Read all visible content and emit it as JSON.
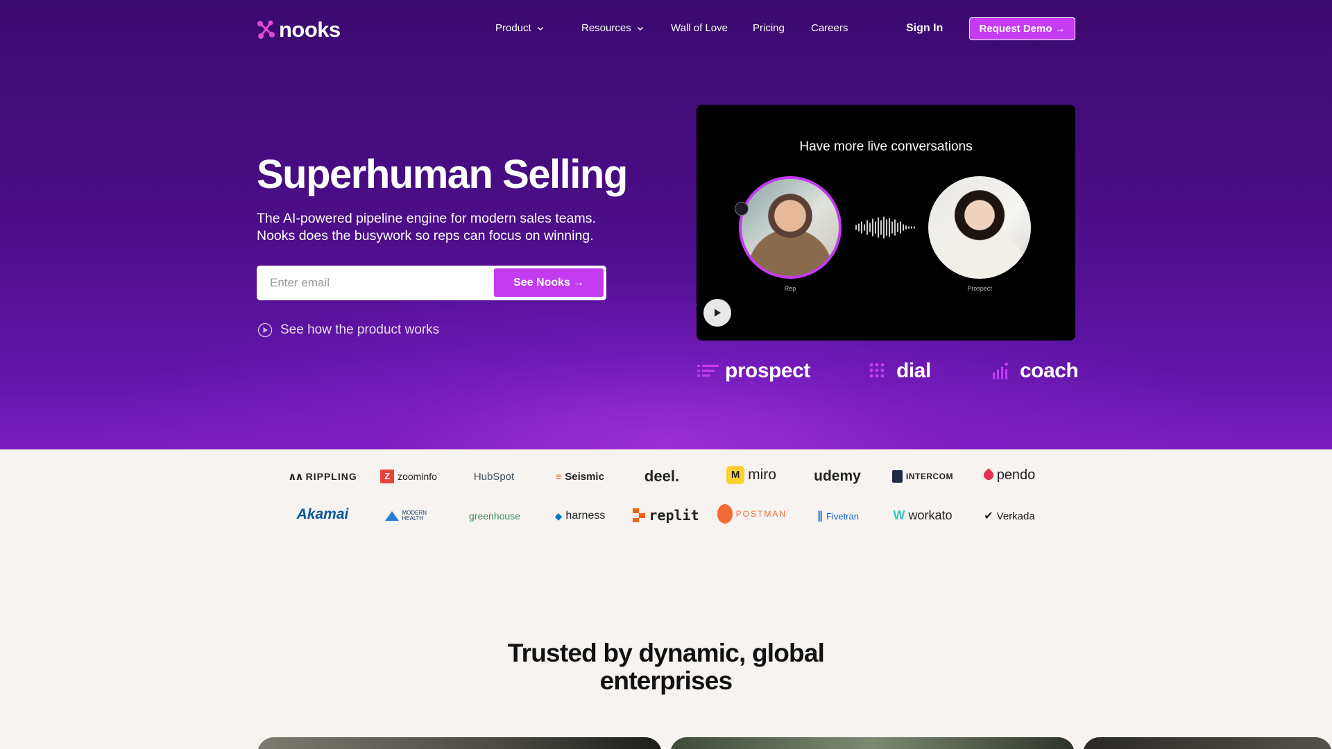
{
  "nav": {
    "brand": "nooks",
    "items": [
      {
        "label": "Product",
        "dropdown": true
      },
      {
        "label": "Resources",
        "dropdown": true
      },
      {
        "label": "Wall of Love",
        "dropdown": false
      },
      {
        "label": "Pricing",
        "dropdown": false
      },
      {
        "label": "Careers",
        "dropdown": false
      }
    ],
    "sign_in": "Sign In",
    "request_demo": "Request Demo",
    "arrow": "→"
  },
  "hero": {
    "title": "Superhuman Selling",
    "subtitle_line1": "The AI-powered pipeline engine for modern sales teams.",
    "subtitle_line2": "Nooks does the busywork so reps can focus on winning.",
    "email_placeholder": "Enter email",
    "email_value": "",
    "cta": "See Nooks",
    "how_link": "See how the product works"
  },
  "video": {
    "caption": "Have more live conversations",
    "rep_label": "Rep",
    "prospect_label": "Prospect"
  },
  "products": [
    {
      "name": "prospect"
    },
    {
      "name": "dial"
    },
    {
      "name": "coach"
    }
  ],
  "customer_logos": {
    "row1": [
      "RIPPLING",
      "zoominfo",
      "HubSpot",
      "Seismic",
      "deel.",
      "miro",
      "udemy",
      "INTERCOM",
      "pendo"
    ],
    "row2": [
      "Akamai",
      "MODERN HEALTH",
      "greenhouse",
      "harness",
      "replit",
      "POSTMAN",
      "Fivetran",
      "workato",
      "Verkada"
    ]
  },
  "trust": {
    "title_line1": "Trusted by dynamic, global",
    "title_line2": "enterprises"
  },
  "colors": {
    "accent": "#c43bf2",
    "hero_bg": "#4a0d85",
    "page_bg": "#f6f3f0"
  }
}
